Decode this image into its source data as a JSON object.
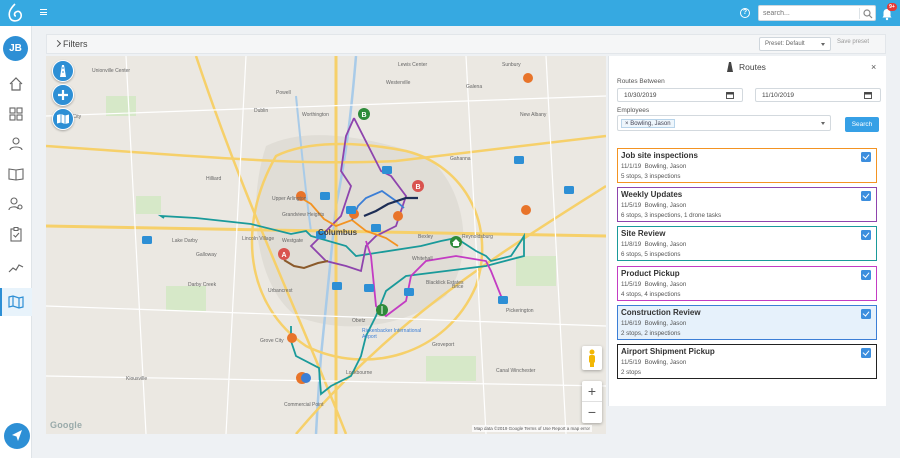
{
  "topbar": {
    "search_placeholder": "search...",
    "notifications_badge": "9+",
    "brand_color": "#36a9e1",
    "icons": [
      "logo-icon",
      "menu-icon",
      "help-icon",
      "search-icon",
      "bell-icon"
    ]
  },
  "sidebar": {
    "avatar_initials": "JB",
    "items": [
      "home-icon",
      "grid-icon",
      "person-icon",
      "book-icon",
      "user-search-icon",
      "clipboard-icon",
      "chart-icon",
      "map-icon"
    ],
    "active_item": "map-icon"
  },
  "filters": {
    "label": "Filters",
    "preset_value": "Preset: Default",
    "save_preset_label": "Save preset"
  },
  "map": {
    "city_label": "Columbus",
    "zoom_in_label": "+",
    "zoom_out_label": "−",
    "google_label": "Google",
    "attribution": "Map data ©2019 Google   Terms of Use   Report a map error",
    "place_labels": [
      "Unionville Center",
      "Plain City",
      "Dublin",
      "Hilliard",
      "Lake Darby",
      "Lincoln Village",
      "Westgate",
      "Darby Creek",
      "Urbancrest",
      "Grove City",
      "Kiousville",
      "Commercial Point",
      "Lockbourne",
      "Obetz",
      "Rickenbacker International Airport",
      "Reynoldsburg",
      "Brice",
      "Pickerington",
      "Whitehall",
      "Blacklick Estates",
      "Canal Winchester",
      "Worthington",
      "Westerville",
      "Gahanna",
      "Lewis Center",
      "Galena",
      "Sunbury",
      "New Albany",
      "Powell",
      "Upper Arlington",
      "Grandview Heights",
      "Bexley",
      "Groveport",
      "Galloway"
    ],
    "marker_labels": [
      "B",
      "A",
      "B"
    ]
  },
  "routes_panel": {
    "title": "Routes",
    "close_label": "×",
    "routes_between_label": "Routes Between",
    "date_from": "10/30/2019",
    "date_to": "11/10/2019",
    "employees_label": "Employees",
    "employee_chip": "Bowling, Jason",
    "chip_remove": "×",
    "search_label": "Search",
    "routes": [
      {
        "name": "Job site inspections",
        "date": "11/1/19",
        "employee": "Bowling, Jason",
        "stats": "5 stops, 3 inspections",
        "color": "#f39322",
        "checked": true
      },
      {
        "name": "Weekly Updates",
        "date": "11/5/19",
        "employee": "Bowling, Jason",
        "stats": "6 stops, 3 inspections, 1 drone tasks",
        "color": "#8e44ad",
        "checked": true
      },
      {
        "name": "Site Review",
        "date": "11/8/19",
        "employee": "Bowling, Jason",
        "stats": "6 stops, 5 inspections",
        "color": "#1a9a9a",
        "checked": true
      },
      {
        "name": "Product Pickup",
        "date": "11/5/19",
        "employee": "Bowling, Jason",
        "stats": "4 stops, 4 inspections",
        "color": "#c33cc3",
        "checked": true
      },
      {
        "name": "Construction Review",
        "date": "11/6/19",
        "employee": "Bowling, Jason",
        "stats": "2 stops, 2 inspections",
        "color": "#3b7ed6",
        "checked": true,
        "selected": true
      },
      {
        "name": "Airport Shipment Pickup",
        "date": "11/5/19",
        "employee": "Bowling, Jason",
        "stats": "2 stops",
        "color": "#222222",
        "checked": true
      }
    ]
  }
}
